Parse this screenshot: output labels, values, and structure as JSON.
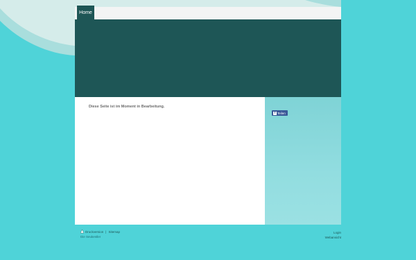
{
  "nav": {
    "tabs": [
      {
        "label": "Home"
      }
    ]
  },
  "content": {
    "message": "Diese Seite ist im Moment in Bearbeitung."
  },
  "sidebar": {
    "share_label": "Teilen"
  },
  "footer": {
    "print_label": "Druckversion",
    "separator": "|",
    "sitemap_label": "Sitemap",
    "sub_text": "Die Seukestler",
    "login_label": "Login",
    "more_label": "Webansicht"
  },
  "colors": {
    "background": "#4fd3d8",
    "header": "#1e5656",
    "content": "#ffffff",
    "share_button": "#3b5998"
  }
}
